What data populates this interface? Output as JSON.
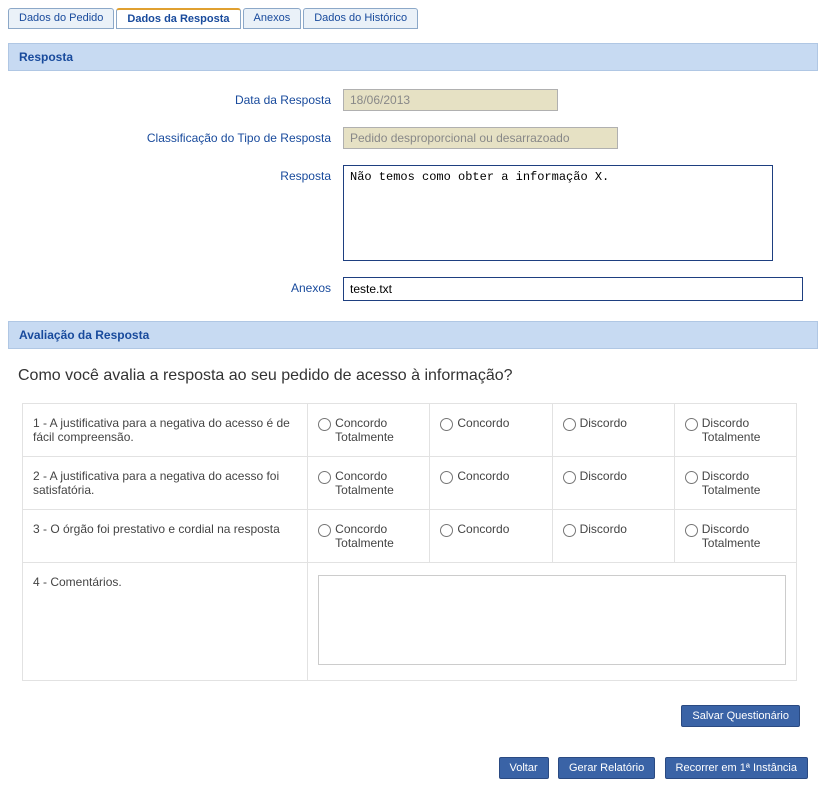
{
  "tabs": {
    "t1": "Dados do Pedido",
    "t2": "Dados da Resposta",
    "t3": "Anexos",
    "t4": "Dados do Histórico"
  },
  "section_resposta": {
    "title": "Resposta",
    "labels": {
      "data": "Data da Resposta",
      "classificacao": "Classificação do Tipo de Resposta",
      "resposta": "Resposta",
      "anexos": "Anexos"
    },
    "values": {
      "data": "18/06/2013",
      "classificacao": "Pedido desproporcional ou desarrazoado",
      "resposta": "Não temos como obter a informação X.",
      "anexos": "teste.txt"
    }
  },
  "section_avaliacao": {
    "title": "Avaliação da Resposta",
    "question_header": "Como você avalia a resposta ao seu pedido de acesso à informação?",
    "options": {
      "ct": "Concordo Totalmente",
      "c": "Concordo",
      "d": "Discordo",
      "dt": "Discordo Totalmente"
    },
    "rows": {
      "q1": "1 - A justificativa para a negativa do acesso é de fácil compreensão.",
      "q2": "2 - A justificativa para a negativa do acesso foi satisfatória.",
      "q3": "3 - O órgão foi prestativo e cordial na resposta",
      "q4": "4 - Comentários."
    }
  },
  "buttons": {
    "salvar": "Salvar Questionário",
    "voltar": "Voltar",
    "relatorio": "Gerar Relatório",
    "recorrer": "Recorrer em 1ª Instância"
  }
}
